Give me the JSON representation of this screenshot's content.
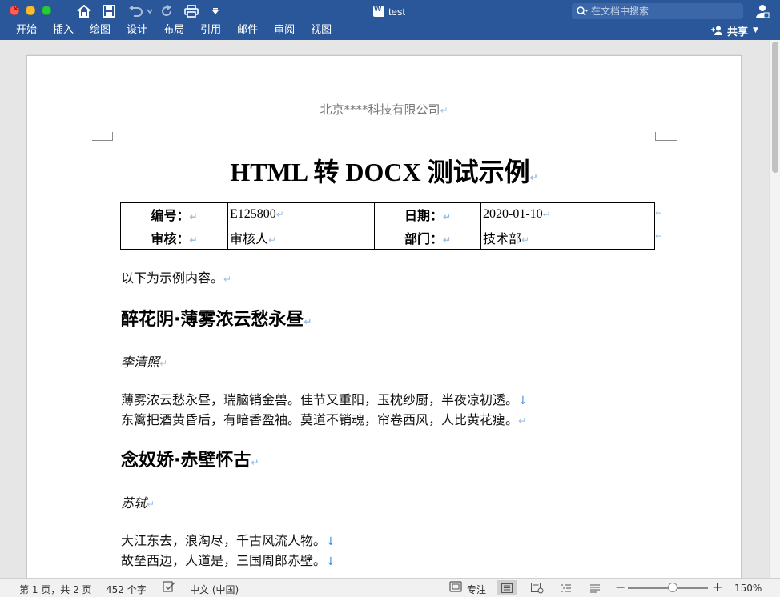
{
  "window": {
    "title": "test"
  },
  "toolbar": {
    "home_icon": "home-icon",
    "save_icon": "save-icon",
    "undo_icon": "undo-icon",
    "redo_icon": "redo-icon",
    "print_icon": "print-icon",
    "customize_icon": "customize-toolbar-icon"
  },
  "search": {
    "placeholder": "在文档中搜索"
  },
  "ribbon": {
    "tabs": [
      {
        "label": "开始"
      },
      {
        "label": "插入"
      },
      {
        "label": "绘图"
      },
      {
        "label": "设计"
      },
      {
        "label": "布局"
      },
      {
        "label": "引用"
      },
      {
        "label": "邮件"
      },
      {
        "label": "审阅"
      },
      {
        "label": "视图"
      }
    ],
    "share_label": "共享"
  },
  "document": {
    "header": "北京****科技有限公司",
    "title": "HTML 转 DOCX 测试示例",
    "table": {
      "rows": [
        [
          "编号：",
          "E125800",
          "日期：",
          "2020-01-10"
        ],
        [
          "审核：",
          "审核人",
          "部门：",
          "技术部"
        ]
      ]
    },
    "intro": "以下为示例内容。",
    "poem1": {
      "title": "醉花阴·薄雾浓云愁永昼",
      "author": "李清照",
      "lines": [
        "薄雾浓云愁永昼，瑞脑销金兽。佳节又重阳，玉枕纱厨，半夜凉初透。",
        "东篱把酒黄昏后，有暗香盈袖。莫道不销魂，帘卷西风，人比黄花瘦。"
      ]
    },
    "poem2": {
      "title": "念奴娇·赤壁怀古",
      "author": "苏轼",
      "lines": [
        "大江东去，浪淘尽，千古风流人物。",
        "故垒西边，人道是，三国周郎赤壁。"
      ]
    }
  },
  "statusbar": {
    "page_info": "第 1 页，共 2 页",
    "word_count": "452 个字",
    "language": "中文 (中国)",
    "focus_label": "专注",
    "zoom": "150%"
  },
  "colors": {
    "titlebar": "#2a579a",
    "paragraph_mark": "#9cbfe3",
    "line_break_mark": "#4a90d9"
  }
}
